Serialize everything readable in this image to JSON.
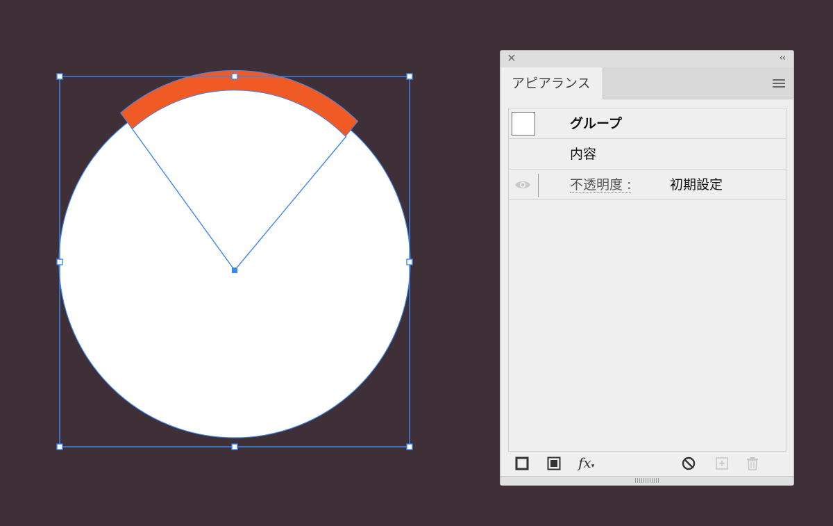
{
  "canvas": {
    "background": "#3f2f36",
    "circle_fill": "#ffffff",
    "arc_color": "#f05a24",
    "selection_color": "#3d86f2"
  },
  "panel": {
    "close_icon": "close-icon",
    "collapse_glyph": "‹‹",
    "tab_label": "アピアランス",
    "menu_icon": "hamburger-menu-icon",
    "rows": {
      "group_label": "グループ",
      "contents_label": "内容",
      "opacity_label": "不透明度 :",
      "opacity_value": "初期設定"
    },
    "toolbar": {
      "add_stroke": "add-new-stroke-icon",
      "add_fill": "add-new-fill-icon",
      "fx_label": "fx",
      "clear": "clear-appearance-icon",
      "duplicate": "duplicate-item-icon",
      "delete": "delete-item-icon"
    }
  }
}
